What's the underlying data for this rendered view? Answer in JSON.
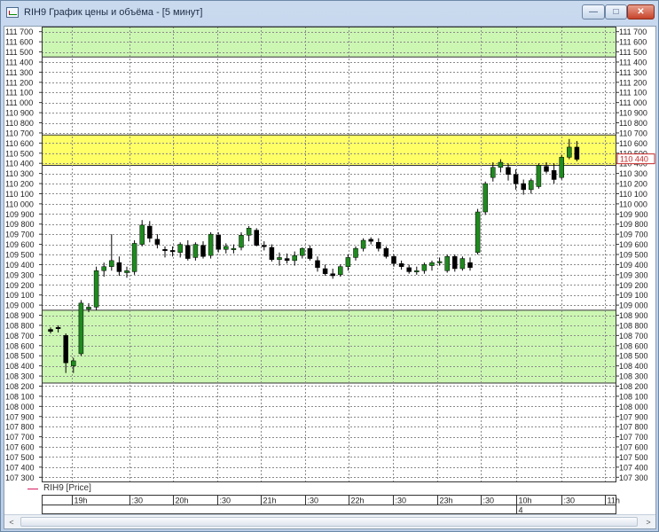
{
  "window": {
    "title": "RIH9 График цены и объёма - [5 минут]",
    "minimize_glyph": "—",
    "maximize_glyph": "□",
    "close_glyph": "✕",
    "icon": "chart-window-icon"
  },
  "legend": {
    "series_label": "RIH9 [Price]",
    "color": "#d81b60"
  },
  "scrollbar": {
    "left_glyph": "<",
    "right_glyph": ">"
  },
  "colors": {
    "zone_green": "#ccf7b3",
    "zone_yellow": "#ffff66",
    "up_candle": "#1f8a1f",
    "down_candle": "#000000",
    "last_price": "#c62828"
  },
  "chart_data": {
    "type": "candlestick",
    "ylim": [
      107250,
      111750
    ],
    "y_ticks": [
      111700,
      111600,
      111500,
      111400,
      111300,
      111200,
      111100,
      111000,
      110900,
      110800,
      110700,
      110600,
      110500,
      110400,
      110300,
      110200,
      110100,
      110000,
      109900,
      109800,
      109700,
      109600,
      109500,
      109400,
      109300,
      109200,
      109100,
      109000,
      108900,
      108800,
      108700,
      108600,
      108500,
      108400,
      108300,
      108200,
      108100,
      108000,
      107900,
      107800,
      107700,
      107600,
      107500,
      107400,
      107300
    ],
    "zones": [
      {
        "from": 111450,
        "to": 111750,
        "color": "green"
      },
      {
        "from": 110380,
        "to": 110680,
        "color": "yellow"
      },
      {
        "from": 108230,
        "to": 108950,
        "color": "green"
      }
    ],
    "last_price": "110 440",
    "last_price_value": 110440,
    "time_labels": [
      "19h",
      ":30",
      "20h",
      ":30",
      "21h",
      ":30",
      "22h",
      ":30",
      "23h",
      ":30",
      "10h",
      ":30",
      "11h"
    ],
    "day_label": "4",
    "ohlc": [
      [
        108760,
        108780,
        108720,
        108740
      ],
      [
        108780,
        108800,
        108730,
        108770
      ],
      [
        108700,
        108720,
        108330,
        108430
      ],
      [
        108400,
        108480,
        108330,
        108450
      ],
      [
        108520,
        109050,
        108500,
        109020
      ],
      [
        108960,
        109020,
        108930,
        108980
      ],
      [
        108980,
        109380,
        108950,
        109340
      ],
      [
        109340,
        109420,
        109280,
        109380
      ],
      [
        109380,
        109700,
        109340,
        109440
      ],
      [
        109420,
        109480,
        109290,
        109330
      ],
      [
        109320,
        109380,
        109270,
        109340
      ],
      [
        109330,
        109640,
        109300,
        109610
      ],
      [
        109600,
        109840,
        109580,
        109790
      ],
      [
        109780,
        109830,
        109620,
        109660
      ],
      [
        109650,
        109700,
        109560,
        109600
      ],
      [
        109550,
        109580,
        109470,
        109540
      ],
      [
        109540,
        109580,
        109480,
        109530
      ],
      [
        109520,
        109620,
        109470,
        109600
      ],
      [
        109590,
        109640,
        109440,
        109460
      ],
      [
        109470,
        109620,
        109440,
        109600
      ],
      [
        109590,
        109630,
        109460,
        109480
      ],
      [
        109490,
        109720,
        109460,
        109700
      ],
      [
        109690,
        109720,
        109520,
        109550
      ],
      [
        109550,
        109610,
        109510,
        109580
      ],
      [
        109560,
        109600,
        109510,
        109560
      ],
      [
        109570,
        109720,
        109540,
        109690
      ],
      [
        109690,
        109780,
        109630,
        109760
      ],
      [
        109740,
        109760,
        109580,
        109590
      ],
      [
        109590,
        109630,
        109540,
        109580
      ],
      [
        109570,
        109600,
        109430,
        109450
      ],
      [
        109450,
        109520,
        109390,
        109470
      ],
      [
        109460,
        109510,
        109410,
        109440
      ],
      [
        109440,
        109530,
        109390,
        109490
      ],
      [
        109490,
        109570,
        109460,
        109560
      ],
      [
        109560,
        109590,
        109440,
        109460
      ],
      [
        109440,
        109480,
        109330,
        109370
      ],
      [
        109360,
        109400,
        109290,
        109310
      ],
      [
        109310,
        109360,
        109260,
        109290
      ],
      [
        109300,
        109400,
        109280,
        109380
      ],
      [
        109380,
        109500,
        109340,
        109470
      ],
      [
        109470,
        109580,
        109440,
        109560
      ],
      [
        109560,
        109660,
        109530,
        109640
      ],
      [
        109650,
        109670,
        109600,
        109630
      ],
      [
        109620,
        109660,
        109530,
        109560
      ],
      [
        109560,
        109580,
        109460,
        109480
      ],
      [
        109480,
        109500,
        109380,
        109410
      ],
      [
        109410,
        109440,
        109350,
        109380
      ],
      [
        109370,
        109400,
        109310,
        109330
      ],
      [
        109330,
        109380,
        109300,
        109340
      ],
      [
        109340,
        109420,
        109310,
        109400
      ],
      [
        109390,
        109440,
        109340,
        109420
      ],
      [
        109420,
        109470,
        109390,
        109430
      ],
      [
        109340,
        109500,
        109320,
        109480
      ],
      [
        109480,
        109500,
        109330,
        109360
      ],
      [
        109360,
        109480,
        109340,
        109460
      ],
      [
        109420,
        109470,
        109340,
        109370
      ],
      [
        109520,
        109950,
        109500,
        109920
      ],
      [
        109920,
        110220,
        109890,
        110200
      ],
      [
        110260,
        110410,
        110220,
        110360
      ],
      [
        110360,
        110440,
        110310,
        110410
      ],
      [
        110360,
        110400,
        110230,
        110290
      ],
      [
        110290,
        110340,
        110140,
        110200
      ],
      [
        110200,
        110240,
        110090,
        110140
      ],
      [
        110140,
        110250,
        110100,
        110230
      ],
      [
        110170,
        110400,
        110150,
        110380
      ],
      [
        110370,
        110410,
        110300,
        110320
      ],
      [
        110330,
        110400,
        110200,
        110240
      ],
      [
        110260,
        110480,
        110240,
        110460
      ],
      [
        110460,
        110640,
        110440,
        110560
      ],
      [
        110560,
        110620,
        110420,
        110440
      ]
    ]
  }
}
